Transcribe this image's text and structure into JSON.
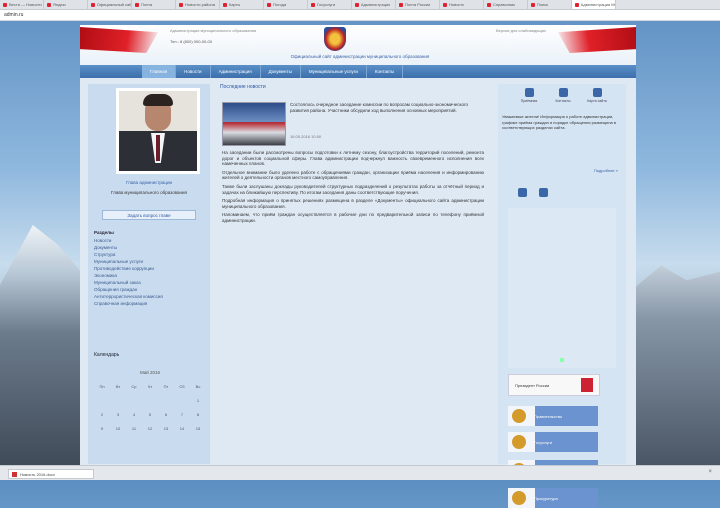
{
  "browser": {
    "tabs": [
      "Вести — Новости",
      "Яндекс",
      "Официальный сайт",
      "Почта",
      "Новости района",
      "Карты",
      "Погода",
      "Госуслуги",
      "Администрация",
      "Почта России",
      "Новости",
      "Справочник",
      "Поиск",
      "Администрация МО"
    ],
    "active_tab_index": 13,
    "url": "admin.ru",
    "download_item": "Новость 2016.docx",
    "download_close": "×"
  },
  "header": {
    "top_left": "Администрация муниципального образования",
    "phone": "Тел.: 8 (800) 000-00-00",
    "top_right": "Версия для слабовидящих",
    "site_title": "Официальный сайт администрации муниципального образования"
  },
  "nav": {
    "items": [
      "Главная",
      "Новости",
      "Администрация",
      "Документы",
      "Муниципальные услуги",
      "Контакты"
    ],
    "active_index": 0
  },
  "left": {
    "person_name": "Глава администрации",
    "person_title": "Глава муниципального образования",
    "question_button": "Задать вопрос главе",
    "menu_header": "Разделы",
    "menu_items": [
      "Новости",
      "Документы",
      "Структура",
      "Муниципальные услуги",
      "Противодействие коррупции",
      "Экономика",
      "Муниципальный заказ",
      "Обращения граждан",
      "Антитеррористическая комиссия",
      "Справочная информация"
    ],
    "calendar_title": "Календарь",
    "calendar_month": "Май 2016",
    "calendar_weekdays": [
      "Пн",
      "Вт",
      "Ср",
      "Чт",
      "Пт",
      "Сб",
      "Вс"
    ],
    "calendar_rows": [
      [
        "",
        "",
        "",
        "",
        "",
        "",
        "1"
      ],
      [
        "2",
        "3",
        "4",
        "5",
        "6",
        "7",
        "8"
      ],
      [
        "9",
        "10",
        "11",
        "12",
        "13",
        "14",
        "15"
      ]
    ]
  },
  "center": {
    "heading": "Последние новости",
    "lead": "Состоялось очередное заседание комиссии по вопросам социально-экономического развития района. Участники обсудили ход выполнения основных мероприятий.",
    "date": "16.05.2016 10:00",
    "paragraphs": [
      "На заседании были рассмотрены вопросы подготовки к летнему сезону, благоустройства территорий поселений, ремонта дорог и объектов социальной сферы. Глава администрации подчеркнул важность своевременного исполнения всех намеченных планов.",
      "Отдельное внимание было уделено работе с обращениями граждан, организации приёма населения и информированию жителей о деятельности органов местного самоуправления.",
      "Также были заслушаны доклады руководителей структурных подразделений о результатах работы за отчётный период и задачах на ближайшую перспективу. По итогам заседания даны соответствующие поручения.",
      "Подробная информация о принятых решениях размещена в разделе «Документы» официального сайта администрации муниципального образования.",
      "Напоминаем, что приём граждан осуществляется в рабочие дни по предварительной записи по телефону приёмной администрации."
    ]
  },
  "right": {
    "icons": [
      "Приёмная",
      "Контакты",
      "Карта сайта"
    ],
    "info": "Уважаемые жители! Информация о работе администрации, графике приёма граждан и порядке обращения размещена в соответствующих разделах сайта.",
    "more_link": "Подробнее »",
    "banners": [
      "Президент России",
      "Правительство",
      "Госуслуги",
      "Портал закупок",
      "Прокуратура"
    ]
  }
}
